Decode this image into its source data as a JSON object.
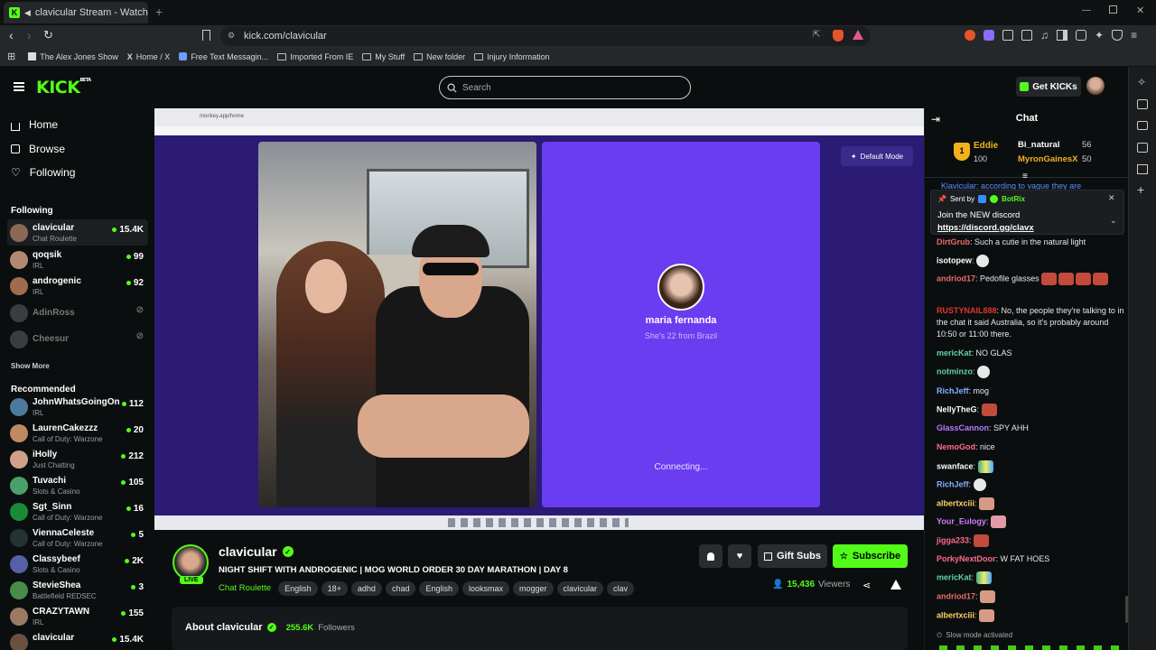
{
  "browser": {
    "tab_title": "clavicular Stream - Watch Liv",
    "url": "kick.com/clavicular",
    "bookmarks": [
      "The Alex Jones Show",
      "Home / X",
      "Free Text Messagin...",
      "Imported From IE",
      "My Stuff",
      "New folder",
      "Injury Information"
    ]
  },
  "header": {
    "logo": "KICK",
    "logo_badge": "BETA",
    "search_placeholder": "Search",
    "get_kicks": "Get KICKs"
  },
  "nav": {
    "home": "Home",
    "browse": "Browse",
    "following": "Following",
    "following_title": "Following",
    "show_more": "Show More",
    "recommended_title": "Recommended"
  },
  "following_channels": [
    {
      "name": "clavicular",
      "category": "Chat Roulette",
      "viewers": "15.4K",
      "live": true
    },
    {
      "name": "qoqsik",
      "category": "IRL",
      "viewers": "99",
      "live": true
    },
    {
      "name": "androgenic",
      "category": "IRL",
      "viewers": "92",
      "live": true
    },
    {
      "name": "AdinRoss",
      "category": "",
      "viewers": "",
      "live": false
    },
    {
      "name": "Cheesur",
      "category": "",
      "viewers": "",
      "live": false
    }
  ],
  "recommended_channels": [
    {
      "name": "JohnWhatsGoingOn",
      "category": "IRL",
      "viewers": "112"
    },
    {
      "name": "LaurenCakezzz",
      "category": "Call of Duty: Warzone",
      "viewers": "20"
    },
    {
      "name": "iHolly",
      "category": "Just Chatting",
      "viewers": "212"
    },
    {
      "name": "Tuvachi",
      "category": "Slots & Casino",
      "viewers": "105"
    },
    {
      "name": "Sgt_Sinn",
      "category": "Call of Duty: Warzone",
      "viewers": "16"
    },
    {
      "name": "ViennaCeleste",
      "category": "Call of Duty: Warzone",
      "viewers": "5"
    },
    {
      "name": "Classybeef",
      "category": "Slots & Casino",
      "viewers": "2K"
    },
    {
      "name": "StevieShea",
      "category": "Battlefield REDSEC",
      "viewers": "3"
    },
    {
      "name": "CRAZYTAWN",
      "category": "IRL",
      "viewers": "155"
    },
    {
      "name": "clavicular",
      "category": "",
      "viewers": "15.4K"
    }
  ],
  "video": {
    "inner_url": "monkey.app/home",
    "default_mode": "Default Mode",
    "profile_name": "maria fernanda",
    "profile_sub": "She's 22 from Brazil",
    "connecting": "Connecting..."
  },
  "stream": {
    "channel": "clavicular",
    "live_badge": "LIVE",
    "title": "NIGHT SHIFT WITH ANDROGENIC | MOG WORLD ORDER 30 DAY MARATHON | DAY 8",
    "category": "Chat Roulette",
    "tags": [
      "English",
      "18+",
      "adhd",
      "chad",
      "English",
      "looksmax",
      "mogger",
      "clavicular",
      "clav"
    ],
    "viewers": "15,436",
    "viewers_label": "Viewers",
    "gift_subs": "Gift Subs",
    "subscribe": "Subscribe",
    "about": "About clavicular",
    "followers": "255.6K",
    "followers_label": "Followers"
  },
  "chat": {
    "title": "Chat",
    "leaderboard": [
      {
        "name": "Eddie",
        "value": "100"
      },
      {
        "name": "Bi_natural",
        "value": "56"
      },
      {
        "name": "MyronGainesX",
        "value": "50"
      }
    ],
    "pinned": {
      "sent_by": "Sent by",
      "bot": "BotRix",
      "text": "Join the NEW discord",
      "link": "https://discord.gg/clavx",
      "behind": "Klavicular: according to vague they are"
    },
    "messages": [
      {
        "user": "DirtGrub",
        "color": "#e86a6a",
        "text": "Such a cutie in the natural light"
      },
      {
        "user": "isotopew",
        "color": "#ffffff",
        "text": ""
      },
      {
        "user": "andriod17",
        "color": "#e86a6a",
        "text": "Pedofile glasses"
      },
      {
        "user": "RUSTYNAIL888",
        "color": "#e0352b",
        "text": "No, the people they're talking to in the chat it said Australia, so it's probably around 10:50 or 11:00 there."
      },
      {
        "user": "mericKat",
        "color": "#5fd3a8",
        "text": "NO GLAS"
      },
      {
        "user": "notminzo",
        "color": "#5fd3a8",
        "text": ""
      },
      {
        "user": "RichJeff",
        "color": "#7fb0ff",
        "text": "mog"
      },
      {
        "user": "NellyTheG",
        "color": "#ffffff",
        "text": ""
      },
      {
        "user": "GlassCannon",
        "color": "#b47cff",
        "text": "SPY AHH"
      },
      {
        "user": "NemoGod",
        "color": "#ff6a8a",
        "text": "nice"
      },
      {
        "user": "swanface",
        "color": "#ffffff",
        "text": ""
      },
      {
        "user": "RichJeff",
        "color": "#7fb0ff",
        "text": ""
      },
      {
        "user": "albertxciii",
        "color": "#ffd166",
        "text": ""
      },
      {
        "user": "Your_Eulogy",
        "color": "#d57bff",
        "text": ""
      },
      {
        "user": "jigga233",
        "color": "#ff6a8a",
        "text": ""
      },
      {
        "user": "PorkyNextDoor",
        "color": "#ff6a8a",
        "text": "W FAT HOES"
      },
      {
        "user": "mericKat",
        "color": "#5fd3a8",
        "text": ""
      },
      {
        "user": "andriod17",
        "color": "#e86a6a",
        "text": ""
      },
      {
        "user": "albertxciii",
        "color": "#ffd166",
        "text": ""
      }
    ],
    "slow_mode": "Slow mode activated"
  },
  "colors": {
    "accent": "#53fc18",
    "video_bg": "#2a1a6e",
    "panel": "#6a3df0"
  }
}
